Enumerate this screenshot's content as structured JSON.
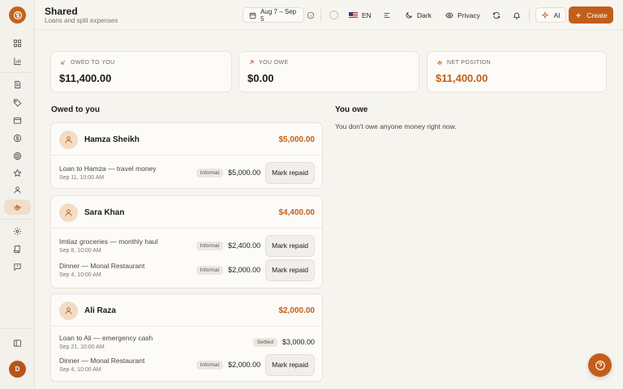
{
  "header": {
    "title": "Shared",
    "subtitle": "Loans and split expenses",
    "date_range": "Aug 7 – Sep 5",
    "language": "EN",
    "theme_label": "Dark",
    "privacy_label": "Privacy",
    "ai_label": "AI",
    "create_label": "Create"
  },
  "sidebar": {
    "avatar_initial": "D",
    "active_item": "shared"
  },
  "summary": [
    {
      "label": "OWED TO YOU",
      "value": "$11,400.00",
      "accent": false
    },
    {
      "label": "YOU OWE",
      "value": "$0.00",
      "accent": false
    },
    {
      "label": "NET POSITION",
      "value": "$11,400.00",
      "accent": true
    }
  ],
  "owed_section": {
    "title": "Owed to you",
    "people": [
      {
        "name": "Hamza Sheikh",
        "total": "$5,000.00",
        "entries": [
          {
            "title": "Loan to Hamza — travel money",
            "date": "Sep 11, 10:00 AM",
            "badge": "Informal",
            "amount": "$5,000.00",
            "action": "Mark repaid"
          }
        ]
      },
      {
        "name": "Sara Khan",
        "total": "$4,400.00",
        "entries": [
          {
            "title": "Imtiaz groceries — monthly haul",
            "date": "Sep 8, 10:00 AM",
            "badge": "Informal",
            "amount": "$2,400.00",
            "action": "Mark repaid"
          },
          {
            "title": "Dinner — Monal Restaurant",
            "date": "Sep 4, 10:00 AM",
            "badge": "Informal",
            "amount": "$2,000.00",
            "action": "Mark repaid"
          }
        ]
      },
      {
        "name": "Ali Raza",
        "total": "$2,000.00",
        "entries": [
          {
            "title": "Loan to Ali — emergency cash",
            "date": "Sep 21, 10:00 AM",
            "badge": "Settled",
            "amount": "$3,000.00",
            "action": ""
          },
          {
            "title": "Dinner — Monal Restaurant",
            "date": "Sep 4, 10:00 AM",
            "badge": "Informal",
            "amount": "$2,000.00",
            "action": "Mark repaid"
          }
        ]
      }
    ]
  },
  "owe_section": {
    "title": "You owe",
    "empty_message": "You don't owe anyone money right now."
  },
  "colors": {
    "accent": "#c25e1a",
    "background": "#f6f4ef",
    "card": "#fcfbf8"
  }
}
